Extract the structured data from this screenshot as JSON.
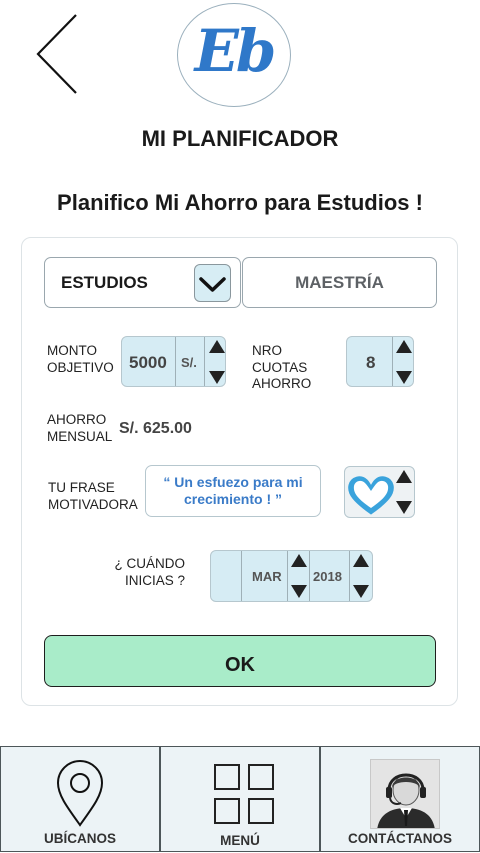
{
  "header": {
    "logo_text": "Eb",
    "app_title": "MI PLANIFICADOR"
  },
  "page": {
    "subtitle": "Planifico Mi Ahorro para Estudios !"
  },
  "form": {
    "category_select": {
      "value": "ESTUDIOS"
    },
    "subcategory": {
      "value": "MAESTRÍA"
    },
    "target_amount": {
      "label_line1": "MONTO",
      "label_line2": "OBJETIVO",
      "value": "5000",
      "currency": "S/."
    },
    "installments": {
      "label_line1": "NRO",
      "label_line2": "CUOTAS",
      "label_line3": "AHORRO",
      "value": "8"
    },
    "monthly_saving": {
      "label_line1": "AHORRO",
      "label_line2": "MENSUAL",
      "value": "S/. 625.00"
    },
    "motivational_phrase": {
      "label_line1": "TU FRASE",
      "label_line2": "MOTIVADORA",
      "value": "“ Un esfuezo para mi crecimiento ! ”"
    },
    "start_date": {
      "label_line1": "¿ CUÁNDO",
      "label_line2": "INICIAS ?",
      "month": "MAR",
      "year": "2018"
    },
    "ok_label": "OK"
  },
  "bottom_nav": {
    "items": [
      {
        "label": "UBÍCANOS",
        "icon": "location-pin-icon"
      },
      {
        "label": "MENÚ",
        "icon": "grid-menu-icon"
      },
      {
        "label": "CONTÁCTANOS",
        "icon": "support-agent-icon"
      }
    ]
  },
  "colors": {
    "accent_blue": "#2f78c9",
    "stepper_bg": "#d6ecf4",
    "ok_green": "#a9ecc9",
    "nav_bg": "#ecf3f6"
  }
}
